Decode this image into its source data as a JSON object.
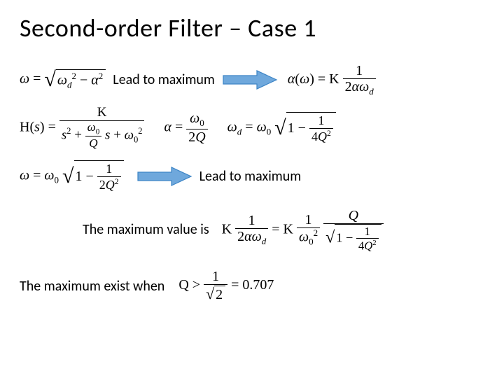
{
  "title": "Second-order Filter – Case 1",
  "labels": {
    "lead_to_max_1": "Lead to maximum",
    "lead_to_max_2": "Lead to maximum",
    "max_value_is": "The maximum value is",
    "max_exist_when": "The maximum exist when"
  },
  "formulas": {
    "omega_root": {
      "lhs": "ω",
      "rhs_under_root": "ω_d^2 − α^2"
    },
    "alpha_omega": {
      "lhs": "α(ω)",
      "rhs": "K · 1 / (2 α ω_d)"
    },
    "H_s": {
      "lhs": "H(s)",
      "rhs": "K / ( s^2 + (ω_0 / Q) s + ω_0^2 )"
    },
    "alpha": {
      "lhs": "α",
      "rhs": "ω_0 / (2Q)"
    },
    "omega_d": {
      "lhs": "ω_d",
      "rhs": "ω_0 · √(1 − 1/(4Q^2))"
    },
    "omega_result": {
      "lhs": "ω",
      "rhs": "ω_0 · √(1 − 1/(2Q^2))"
    },
    "max_value": {
      "expr": "K · 1/(2 α ω_d) = K · (1/ω_0^2) · Q / √(1 − 1/(4Q^2))"
    },
    "q_threshold": {
      "expr": "Q > 1/√2 = 0.707"
    }
  },
  "colors": {
    "arrow_fill": "#6FA8DC",
    "arrow_stroke": "#3D85C6"
  }
}
